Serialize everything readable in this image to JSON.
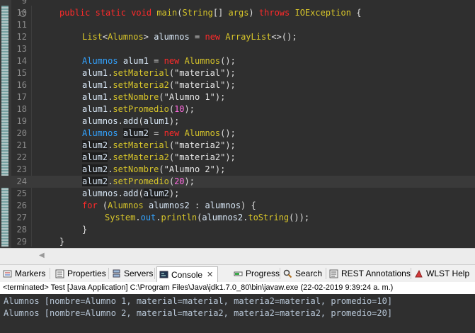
{
  "editor": {
    "line_numbers": [
      "9",
      "10",
      "11",
      "12",
      "13",
      "14",
      "15",
      "16",
      "17",
      "18",
      "19",
      "20",
      "21",
      "22",
      "23",
      "24",
      "25",
      "26",
      "27",
      "28",
      "29"
    ],
    "code": {
      "l10": {
        "k1": "public",
        "k2": "static",
        "k3": "void",
        "m": "main",
        "p1": "(",
        "t1": "String",
        "p2": "[]",
        "v1": "args",
        "p3": ")",
        "k4": "throws",
        "t2": "IOException",
        "p4": "{"
      },
      "l12": {
        "t1": "List",
        "p1": "<",
        "t2": "Alumnos",
        "p2": ">",
        "v1": "alumnos",
        "p3": "=",
        "k1": "new",
        "t3": "ArrayList",
        "p4": "<>();"
      },
      "l14": {
        "t1": "Alumnos",
        "v1": "alum1",
        "p1": "=",
        "k1": "new",
        "t2": "Alumnos",
        "p2": "();"
      },
      "l15": {
        "v1": "alum1",
        "p1": ".",
        "m": "setMaterial",
        "p2": "(",
        "s": "\"material\"",
        "p3": ");"
      },
      "l16": {
        "v1": "alum1",
        "p1": ".",
        "m": "setMateria2",
        "p2": "(",
        "s": "\"material\"",
        "p3": ");"
      },
      "l17": {
        "v1": "alum1",
        "p1": ".",
        "m": "setNombre",
        "p2": "(",
        "s": "\"Alumno 1\"",
        "p3": ");"
      },
      "l18": {
        "v1": "alum1",
        "p1": ".",
        "m": "setPromedio",
        "p2": "(",
        "n": "10",
        "p3": ");"
      },
      "l19": {
        "v1": "alumnos",
        "p1": ".",
        "m": "add",
        "p2": "(",
        "v2": "alum1",
        "p3": ");"
      },
      "l20": {
        "t1": "Alumnos",
        "v1": "alum2",
        "p1": "=",
        "k1": "new",
        "t2": "Alumnos",
        "p2": "();"
      },
      "l21": {
        "v1": "alum2",
        "p1": ".",
        "m": "setMaterial",
        "p2": "(",
        "s": "\"materia2\"",
        "p3": ");"
      },
      "l22": {
        "v1": "alum2",
        "p1": ".",
        "m": "setMateria2",
        "p2": "(",
        "s": "\"materia2\"",
        "p3": ");"
      },
      "l23": {
        "v1": "alum2",
        "p1": ".",
        "m": "setNombre",
        "p2": "(",
        "s": "\"Alumno 2\"",
        "p3": ");"
      },
      "l24": {
        "v1": "alum2",
        "p1": ".",
        "m": "setPromedio",
        "p2": "(",
        "n": "20",
        "p3": ");"
      },
      "l25": {
        "v1": "alumnos",
        "p1": ".",
        "m": "add",
        "p2": "(",
        "v2": "alum2",
        "p3": ");"
      },
      "l26": {
        "k1": "for",
        "p1": "(",
        "t1": "Alumnos",
        "v1": "alumnos2",
        "p2": ":",
        "v2": "alumnos",
        "p3": ")",
        "p4": "{"
      },
      "l27": {
        "t1": "System",
        "p1": ".",
        "f": "out",
        "p2": ".",
        "m1": "println",
        "p3": "(",
        "v1": "alumnos2",
        "p4": ".",
        "m2": "toString",
        "p5": "());"
      },
      "l28": {
        "p1": "}"
      },
      "l29": {
        "p1": "}"
      }
    }
  },
  "tabs": [
    {
      "label": "Markers",
      "icon": "markers-icon"
    },
    {
      "label": "Properties",
      "icon": "properties-icon"
    },
    {
      "label": "Servers",
      "icon": "servers-icon"
    },
    {
      "label": "Console",
      "icon": "console-icon",
      "active": true,
      "close": "✕"
    },
    {
      "label": "Progress",
      "icon": "progress-icon"
    },
    {
      "label": "Search",
      "icon": "search-icon"
    },
    {
      "label": "REST Annotations",
      "icon": "rest-annotations-icon"
    },
    {
      "label": "WLST Help",
      "icon": "wlst-help-icon"
    }
  ],
  "console": {
    "header": "<terminated> Test [Java Application] C:\\Program Files\\Java\\jdk1.7.0_80\\bin\\javaw.exe (22-02-2019 9:39:24 a. m.)",
    "lines": [
      "Alumnos [nombre=Alumno 1, material=material, materia2=material, promedio=10]",
      "Alumnos [nombre=Alumno 2, material=materia2, materia2=materia2, promedio=20]"
    ]
  },
  "colors": {
    "keyword": "#ff2a2a",
    "type": "#d7c52a",
    "number": "#ff6be0",
    "static_field": "#33a3ff",
    "editor_bg": "#2f2f2f"
  }
}
